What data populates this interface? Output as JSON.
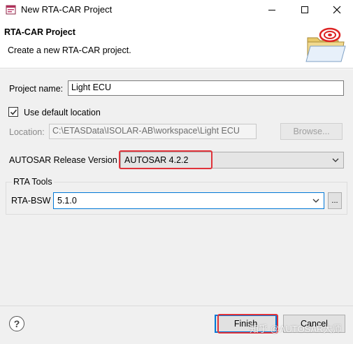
{
  "window": {
    "title": "New RTA-CAR Project",
    "icon": "wizard-app-icon"
  },
  "header": {
    "title": "RTA-CAR Project",
    "description": "Create a new RTA-CAR project.",
    "banner_icon": "folder-with-target-icon"
  },
  "form": {
    "project_name_label": "Project name:",
    "project_name_value": "Light ECU",
    "use_default_location_label": "Use default location",
    "use_default_location_checked": true,
    "location_label": "Location:",
    "location_value": "C:\\ETASData\\ISOLAR-AB\\workspace\\Light ECU",
    "browse_label": "Browse...",
    "autosar_label": "AUTOSAR Release Version",
    "autosar_value": "AUTOSAR 4.2.2"
  },
  "rta_tools": {
    "group_title": "RTA Tools",
    "bsw_label": "RTA-BSW",
    "bsw_value": "5.1.0",
    "more_label": "..."
  },
  "footer": {
    "help_label": "?",
    "finish_label": "Finish",
    "cancel_label": "Cancel",
    "watermark": "知乎 @AUTOSAR大师"
  },
  "colors": {
    "highlight": "#e0333a",
    "focus": "#0078d7"
  }
}
